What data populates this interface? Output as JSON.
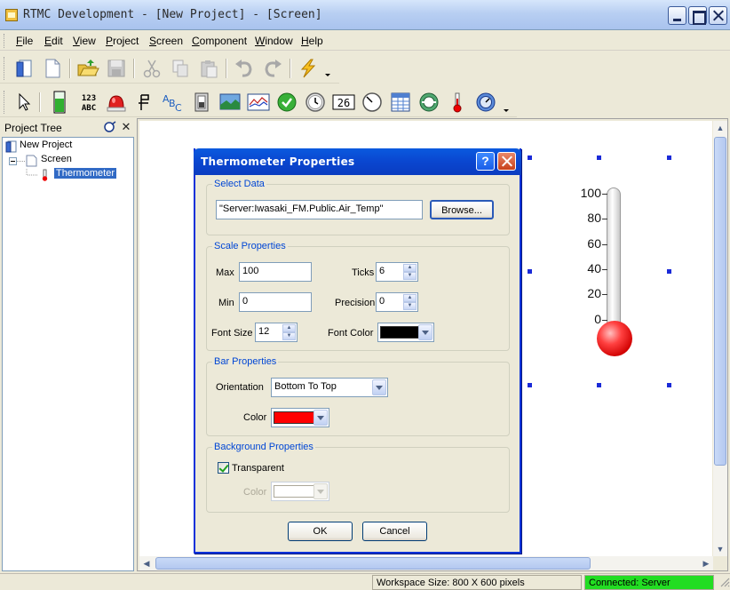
{
  "window": {
    "title": "RTMC Development - [New Project] - [Screen]"
  },
  "menu": [
    {
      "label": "File",
      "u": "F",
      "rest": "ile"
    },
    {
      "label": "Edit",
      "u": "E",
      "rest": "dit"
    },
    {
      "label": "View",
      "u": "V",
      "rest": "iew"
    },
    {
      "label": "Project",
      "u": "P",
      "rest": "roject"
    },
    {
      "label": "Screen",
      "u": "S",
      "rest": "creen"
    },
    {
      "label": "Component",
      "u": "C",
      "rest": "omponent"
    },
    {
      "label": "Window",
      "u": "W",
      "rest": "indow"
    },
    {
      "label": "Help",
      "u": "H",
      "rest": "elp"
    }
  ],
  "toolbar2": {
    "numeric_icon_text": "123\nABC",
    "digital_icon_text": "26"
  },
  "project_tree": {
    "title": "Project Tree",
    "items": [
      {
        "label": "New Project"
      },
      {
        "label": "Screen"
      },
      {
        "label": "Thermometer"
      }
    ]
  },
  "thermometer": {
    "scale_labels": [
      "100",
      "80",
      "60",
      "40",
      "20",
      "0"
    ],
    "fill_fraction": 0.0,
    "bulb_color": "#ff2020"
  },
  "dialog": {
    "title": "Thermometer Properties",
    "help_glyph": "?",
    "select_data": {
      "legend": "Select Data",
      "value": "\"Server:Iwasaki_FM.Public.Air_Temp\"",
      "browse_label": "Browse..."
    },
    "scale": {
      "legend": "Scale Properties",
      "max_label": "Max",
      "max_value": "100",
      "min_label": "Min",
      "min_value": "0",
      "ticks_label": "Ticks",
      "ticks_value": "6",
      "precision_label": "Precision",
      "precision_value": "0",
      "font_size_label": "Font Size",
      "font_size_value": "12",
      "font_color_label": "Font Color",
      "font_color": "#000000"
    },
    "bar": {
      "legend": "Bar Properties",
      "orientation_label": "Orientation",
      "orientation_value": "Bottom To Top",
      "color_label": "Color",
      "color": "#ff0000"
    },
    "background": {
      "legend": "Background Properties",
      "transparent_label": "Transparent",
      "transparent_checked": true,
      "color_label": "Color",
      "color": "#ffffff"
    },
    "ok_label": "OK",
    "cancel_label": "Cancel"
  },
  "status": {
    "workspace_size": "Workspace Size: 800 X 600 pixels",
    "connection": "Connected: Server",
    "connection_color": "#22dd22"
  }
}
